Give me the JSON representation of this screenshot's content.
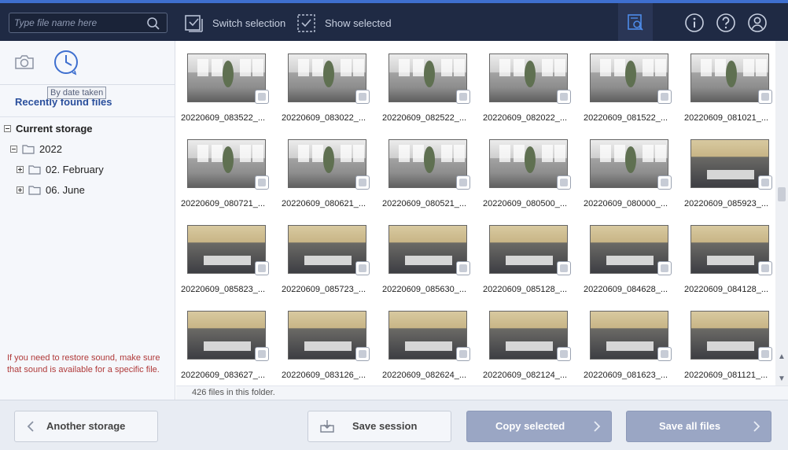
{
  "search": {
    "placeholder": "Type file name here"
  },
  "toolbar": {
    "switch_selection": "Switch selection",
    "show_selected": "Show selected"
  },
  "sidebar": {
    "tooltip": "By date taken",
    "recent": "Recently found files",
    "tree": {
      "root": "Current storage",
      "year": "2022",
      "months": [
        "02. February",
        "06. June"
      ]
    },
    "note": "If you need to restore sound, make sure that sound is available for a specific file."
  },
  "files": [
    "20220609_083522_...",
    "20220609_083022_...",
    "20220609_082522_...",
    "20220609_082022_...",
    "20220609_081522_...",
    "20220609_081021_...",
    "20220609_080721_...",
    "20220609_080621_...",
    "20220609_080521_...",
    "20220609_080500_...",
    "20220609_080000_...",
    "20220609_085923_...",
    "20220609_085823_...",
    "20220609_085723_...",
    "20220609_085630_...",
    "20220609_085128_...",
    "20220609_084628_...",
    "20220609_084128_...",
    "20220609_083627_...",
    "20220609_083126_...",
    "20220609_082624_...",
    "20220609_082124_...",
    "20220609_081623_...",
    "20220609_081121_..."
  ],
  "status": "426 files in this folder.",
  "buttons": {
    "another_storage": "Another storage",
    "save_session": "Save session",
    "copy_selected": "Copy selected",
    "save_all": "Save all files"
  },
  "colors": {
    "topbar": "#1f2a44",
    "accent": "#3e6fcf",
    "primary_button": "#9aa6c4",
    "note_text": "#b03a3a"
  }
}
